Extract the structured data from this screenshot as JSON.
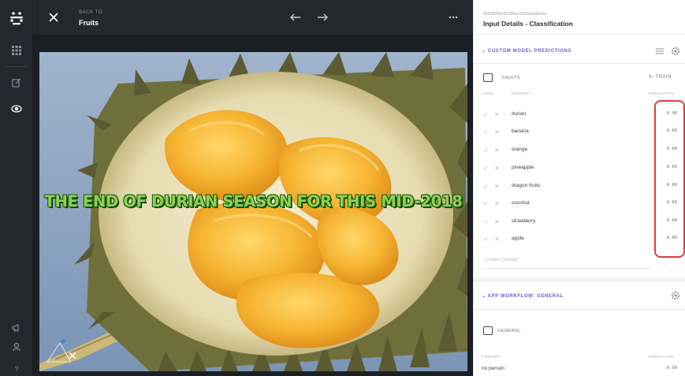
{
  "topbar": {
    "back_small": "BACK TO",
    "back_title": "Fruits"
  },
  "image": {
    "caption": "THE END OF DURIAN SEASON FOR THIS MID-2018"
  },
  "panel": {
    "input_id": "5f95d5f35e4f1336ee1f5b1dcab6eee",
    "title": "Input Details - Classification",
    "custom_section": {
      "title": "CUSTOM MODEL PREDICTIONS",
      "model_name": "FRUITS",
      "train_label": "TRAIN",
      "columns": {
        "label": "LABEL",
        "concept": "CONCEPT",
        "prediction": "PREDICTION"
      },
      "rows": [
        {
          "name": "durian",
          "value": "0.98"
        },
        {
          "name": "banana",
          "value": "0.00"
        },
        {
          "name": "orange",
          "value": "0.00"
        },
        {
          "name": "pineapple",
          "value": "0.00"
        },
        {
          "name": "dragon fruits",
          "value": "0.00"
        },
        {
          "name": "coconut",
          "value": "0.00"
        },
        {
          "name": "strawberry",
          "value": "0.00"
        },
        {
          "name": "apple",
          "value": "0.00"
        }
      ],
      "create_placeholder": "Create Concept"
    },
    "workflow_section": {
      "title": "APP WORKFLOW: GENERAL",
      "model_name": "GENERAL",
      "columns": {
        "concept": "CONCEPT",
        "prediction": "PREDICTION"
      },
      "rows": [
        {
          "name": "no person",
          "value": "0.99"
        }
      ]
    }
  },
  "colors": {
    "accent": "#6b5bd0",
    "highlight": "#e23b3b",
    "dark_bg": "#24282e"
  }
}
